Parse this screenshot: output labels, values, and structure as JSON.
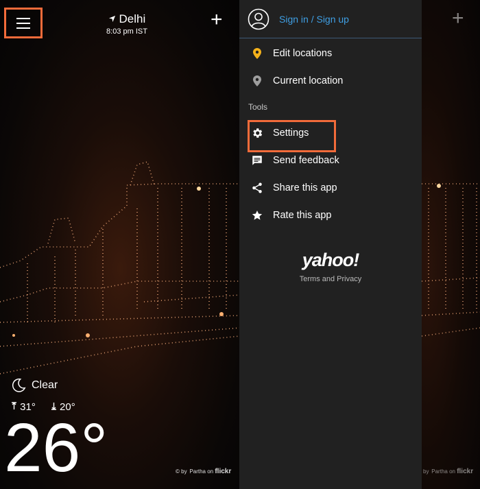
{
  "header": {
    "city": "Delhi",
    "time": "8:03 pm IST",
    "add_symbol": "+"
  },
  "weather": {
    "condition": "Clear",
    "high": "31°",
    "low": "20°",
    "temperature": "26°"
  },
  "credit": {
    "prefix": "by  Partha on",
    "brand": "flickr"
  },
  "drawer": {
    "sign_in_label": "Sign in / Sign up",
    "items": [
      {
        "label": "Edit locations",
        "icon": "pin-icon"
      },
      {
        "label": "Current location",
        "icon": "pin-icon"
      }
    ],
    "tools_heading": "Tools",
    "tools": [
      {
        "label": "Settings",
        "icon": "gear-icon"
      },
      {
        "label": "Send feedback",
        "icon": "feedback-icon"
      },
      {
        "label": "Share this app",
        "icon": "share-icon"
      },
      {
        "label": "Rate this app",
        "icon": "star-icon"
      }
    ],
    "brand": "yahoo!",
    "terms_label": "Terms and Privacy"
  },
  "colors": {
    "highlight": "#f26b3a",
    "link": "#3f9fe4",
    "pin_active": "#f5b21b",
    "drawer_bg": "#212121"
  }
}
